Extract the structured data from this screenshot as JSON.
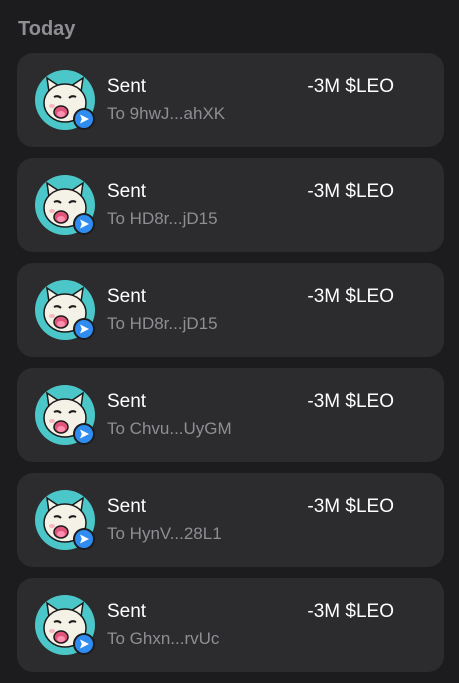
{
  "section": {
    "title": "Today"
  },
  "colors": {
    "card_bg": "#2c2c2e",
    "avatar_bg": "#4cc7c9",
    "badge_bg": "#2f8cf0",
    "subtext": "#8e8e93"
  },
  "transactions": [
    {
      "title": "Sent",
      "recipient": "To 9hwJ...ahXK",
      "amount": "-3M $LEO",
      "avatar_icon": "cat-token-icon",
      "badge_icon": "send-arrow-icon"
    },
    {
      "title": "Sent",
      "recipient": "To HD8r...jD15",
      "amount": "-3M $LEO",
      "avatar_icon": "cat-token-icon",
      "badge_icon": "send-arrow-icon"
    },
    {
      "title": "Sent",
      "recipient": "To HD8r...jD15",
      "amount": "-3M $LEO",
      "avatar_icon": "cat-token-icon",
      "badge_icon": "send-arrow-icon"
    },
    {
      "title": "Sent",
      "recipient": "To Chvu...UyGM",
      "amount": "-3M $LEO",
      "avatar_icon": "cat-token-icon",
      "badge_icon": "send-arrow-icon"
    },
    {
      "title": "Sent",
      "recipient": "To HynV...28L1",
      "amount": "-3M $LEO",
      "avatar_icon": "cat-token-icon",
      "badge_icon": "send-arrow-icon"
    },
    {
      "title": "Sent",
      "recipient": "To Ghxn...rvUc",
      "amount": "-3M $LEO",
      "avatar_icon": "cat-token-icon",
      "badge_icon": "send-arrow-icon"
    }
  ]
}
